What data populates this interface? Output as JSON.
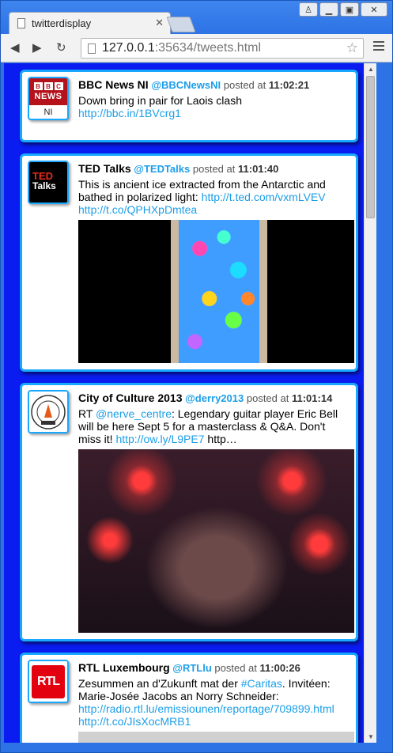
{
  "browser": {
    "tab_title": "twitterdisplay",
    "tab_close": "✕",
    "url_host": "127.0.0.1",
    "url_rest": ":35634/tweets.html"
  },
  "tweets": [
    {
      "name": "BBC News NI",
      "handle": "@BBCNewsNI",
      "posted_label": "posted at",
      "time": "11:02:21",
      "text": "Down bring in pair for Laois clash",
      "link": "http://bbc.in/1BVcrg1",
      "avatar": {
        "blocks": [
          "B",
          "B",
          "C"
        ],
        "line1": "NEWS",
        "line2": "NI"
      }
    },
    {
      "name": "TED Talks",
      "handle": "@TEDTalks",
      "posted_label": "posted at",
      "time": "11:01:40",
      "text": "This is ancient ice extracted from the Antarctic and bathed in polarized light: ",
      "link": "http://t.ted.com/vxmLVEV",
      "link2": "http://t.co/QPHXpDmtea",
      "avatar": {
        "line1": "TED",
        "line2": "Talks"
      }
    },
    {
      "name": "City of Culture 2013",
      "handle": "@derry2013",
      "posted_label": "posted at",
      "time": "11:01:14",
      "text_prefix": "RT ",
      "mention": "@nerve_centre",
      "text": ": Legendary guitar player Eric Bell will be here Sept 5 for a masterclass & Q&A. Don't miss it! ",
      "link": "http://ow.ly/L9PE7",
      "text_suffix": " http…",
      "avatar": {
        "line1": "CITY OF CULTURE",
        "line2": "LEGACY"
      }
    },
    {
      "name": "RTL Luxembourg",
      "handle": "@RTLlu",
      "posted_label": "posted at",
      "time": "11:00:26",
      "text": "Zesummen an d'Zukunft mat der ",
      "hashtag": "#Caritas",
      "text2": ". Invitéen: Marie-Josée Jacobs an Norry Schneider: ",
      "link": "http://radio.rtl.lu/emissiounen/reportage/709899.html",
      "link2": "http://t.co/JIsXocMRB1",
      "avatar": {
        "logo": "RTL"
      }
    }
  ],
  "colors": {
    "page_bg": "#0a1cf0",
    "card_border": "#19a8ff",
    "link": "#1c9ee8"
  }
}
